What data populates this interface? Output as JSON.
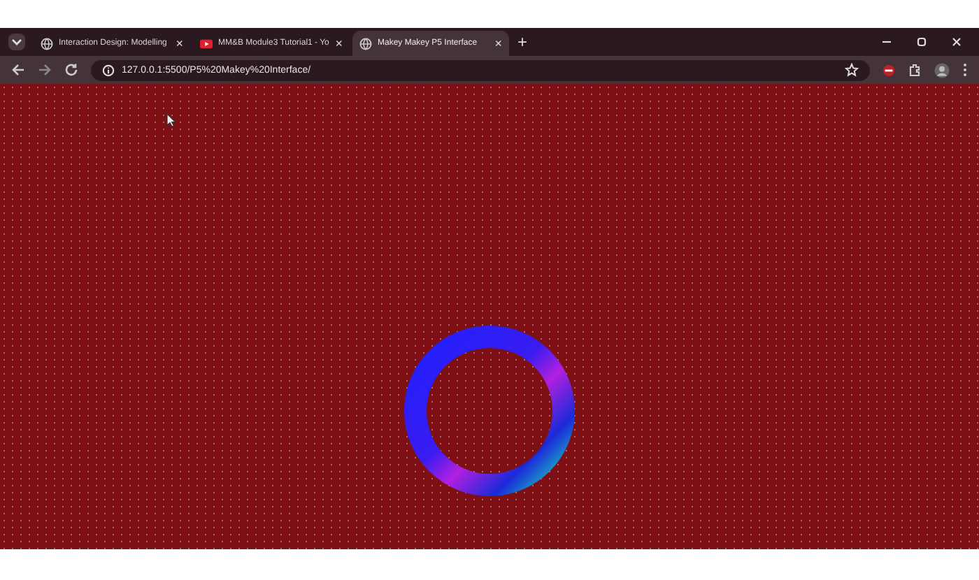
{
  "browser": {
    "tabs": [
      {
        "title": "Interaction Design: Modelling",
        "close": "×",
        "selected": false,
        "kind": "site"
      },
      {
        "title": "MM&B Module3 Tutorial1 - Yo",
        "close": "×",
        "selected": false,
        "kind": "video"
      },
      {
        "title": "Makey Makey P5 Interface",
        "close": "×",
        "selected": true,
        "kind": "site"
      }
    ],
    "new_tab": "+",
    "address": "127.0.0.1:5500/P5%20Makey%20Interface/"
  }
}
